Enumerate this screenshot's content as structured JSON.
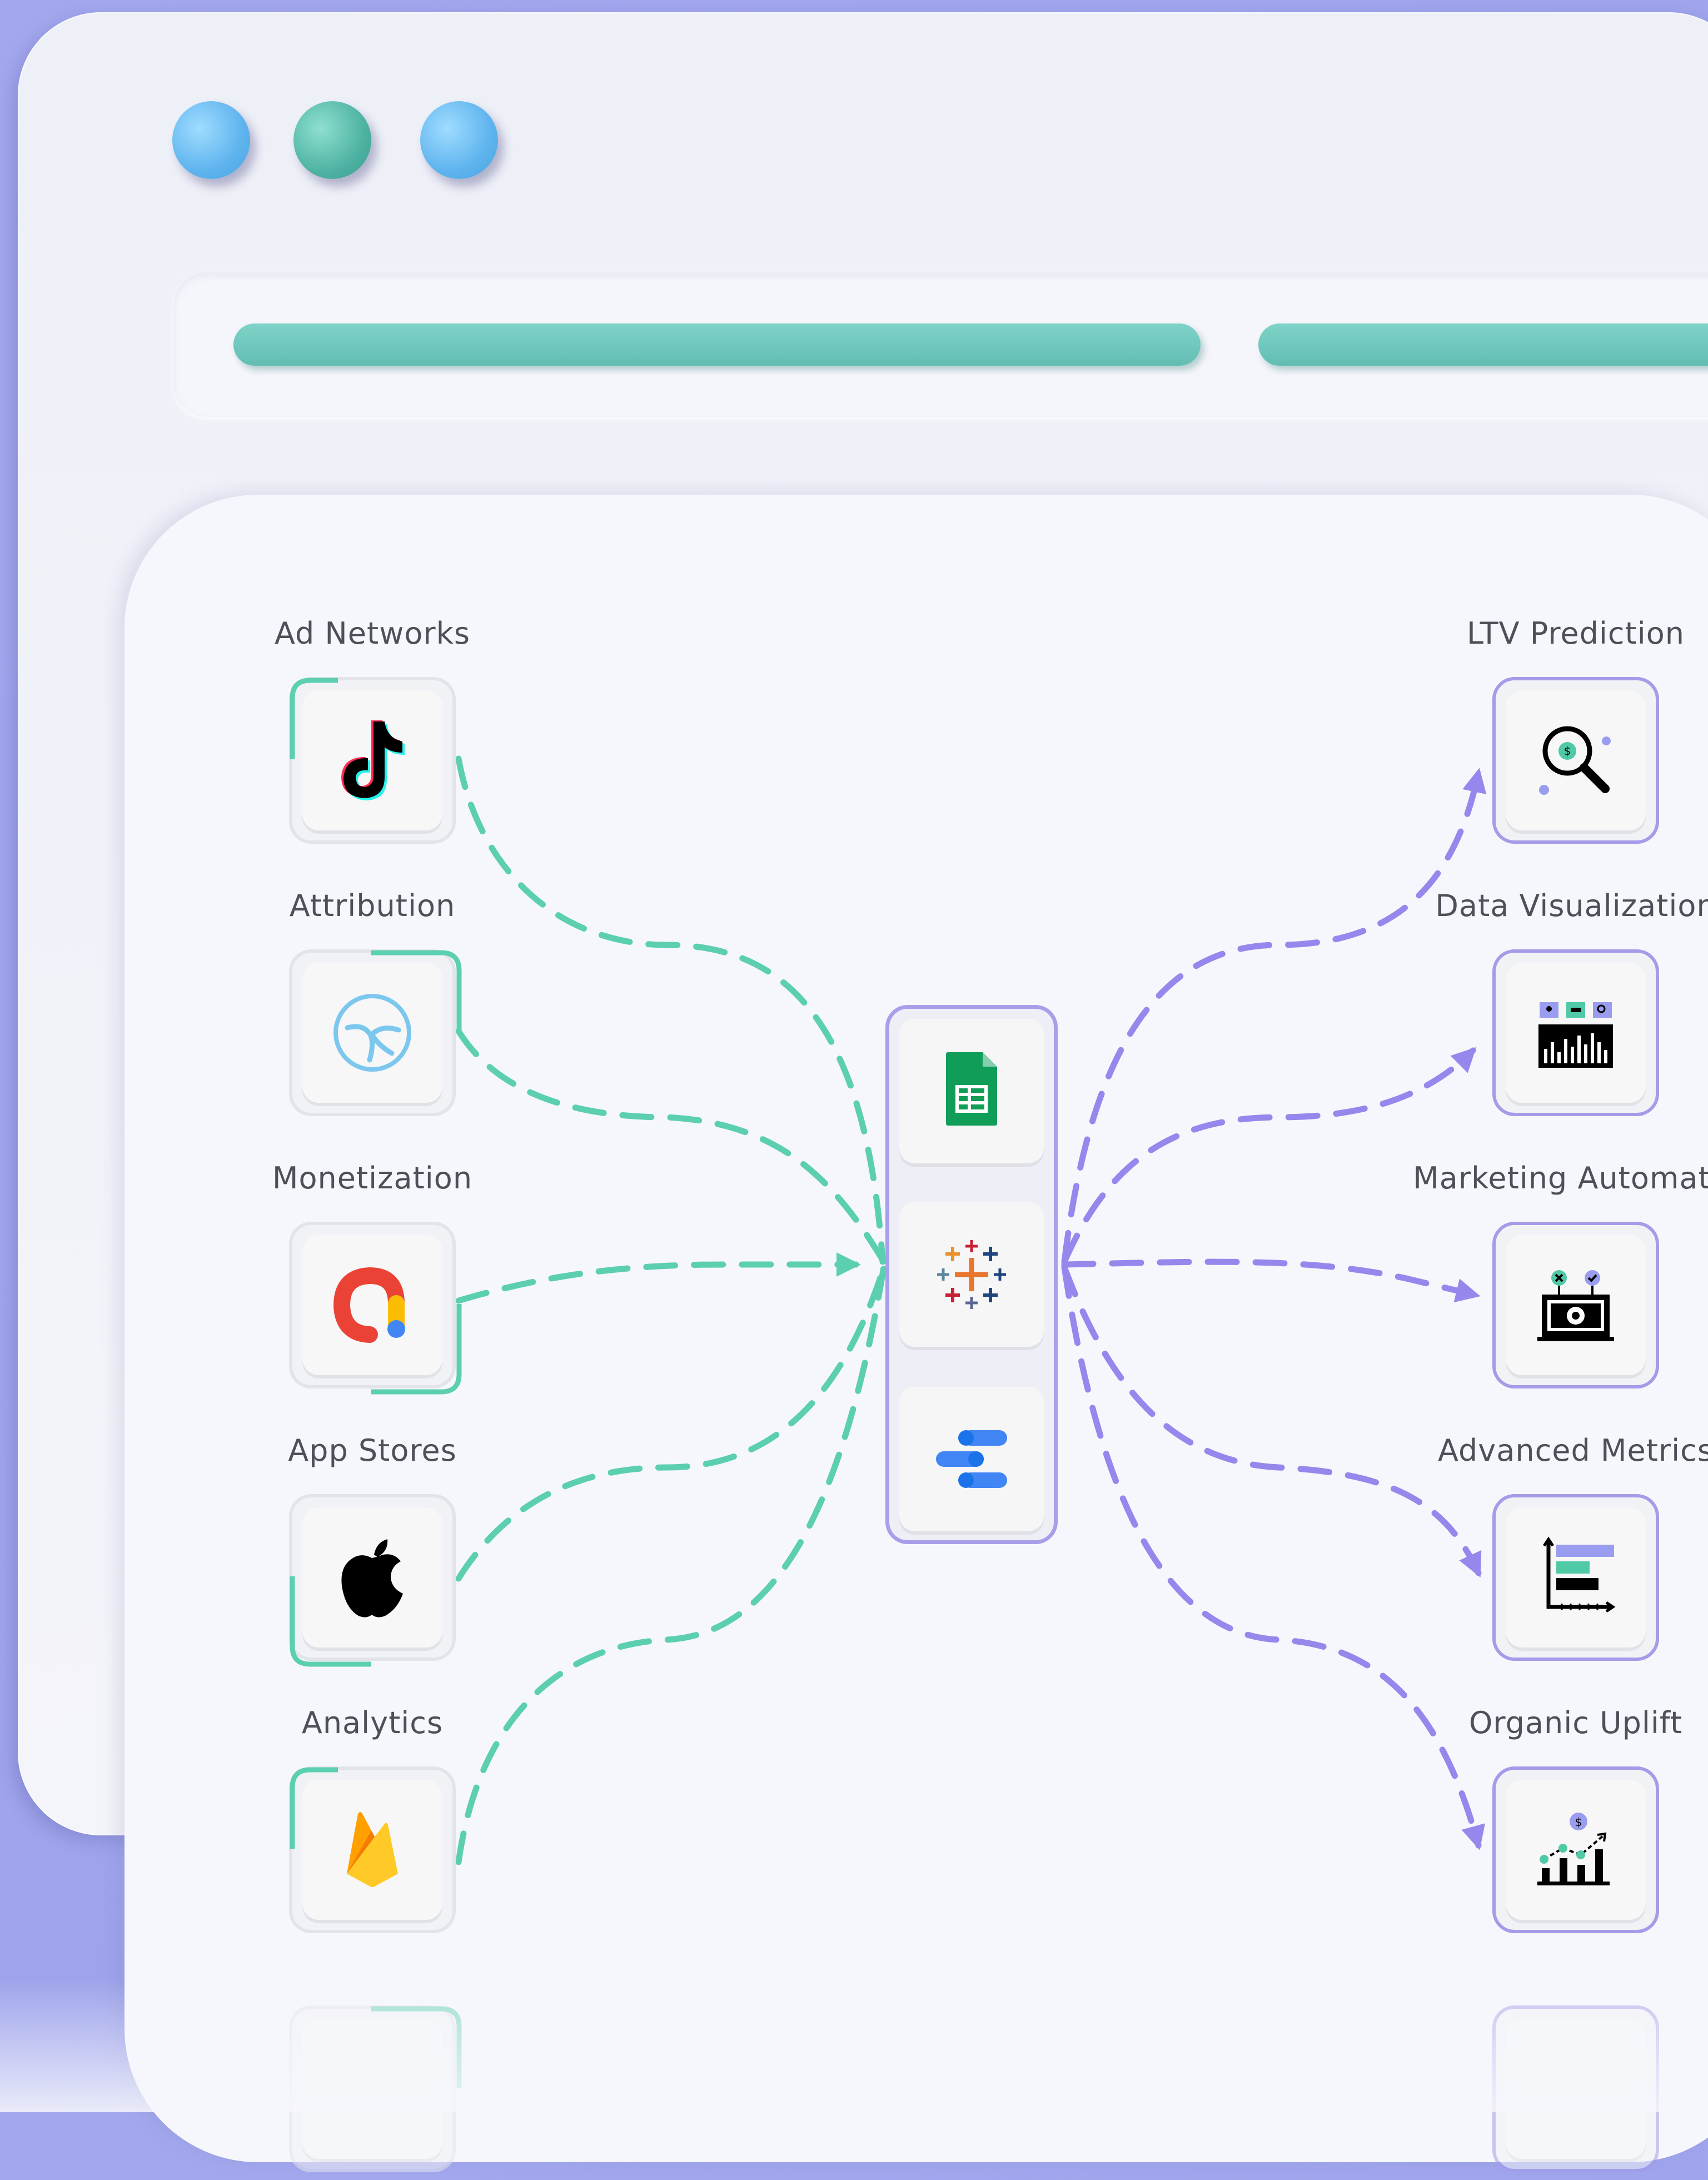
{
  "window": {
    "traffic_lights": [
      {
        "name": "close",
        "color": "#6cbcf2"
      },
      {
        "name": "minimize",
        "color": "#5cbfae"
      },
      {
        "name": "maximize",
        "color": "#6cbcf2"
      }
    ]
  },
  "colors": {
    "source_accent": "#5ccfb0",
    "destination_accent": "#9588ec",
    "background": "#a3a8ee"
  },
  "sources": [
    {
      "label": "Ad Networks",
      "icon": "tiktok-icon"
    },
    {
      "label": "Attribution",
      "icon": "attribution-icon"
    },
    {
      "label": "Monetization",
      "icon": "admob-icon"
    },
    {
      "label": "App Stores",
      "icon": "apple-icon"
    },
    {
      "label": "Analytics",
      "icon": "firebase-icon"
    }
  ],
  "hub": {
    "tools": [
      {
        "icon": "google-sheets-icon"
      },
      {
        "icon": "tableau-icon"
      },
      {
        "icon": "looker-studio-icon"
      }
    ]
  },
  "destinations": [
    {
      "label": "LTV Prediction",
      "icon": "ltv-search-icon"
    },
    {
      "label": "Data Visualization",
      "icon": "dashboard-chart-icon"
    },
    {
      "label": "Marketing Automatio",
      "icon": "automation-gear-icon"
    },
    {
      "label": "Advanced Metrics",
      "icon": "bar-metrics-icon"
    },
    {
      "label": "Organic Uplift",
      "icon": "uplift-chart-icon"
    }
  ]
}
